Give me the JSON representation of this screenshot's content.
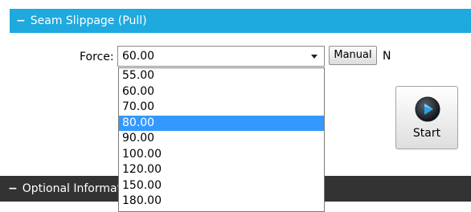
{
  "seam_section": {
    "toggle_symbol": "−",
    "title": "Seam Slippage (Pull)",
    "color": "#1ea9df"
  },
  "force": {
    "label": "Force:",
    "selected_value": "60.00",
    "highlighted_option": "80.00",
    "options": [
      "55.00",
      "60.00",
      "70.00",
      "80.00",
      "90.00",
      "100.00",
      "120.00",
      "150.00",
      "180.00"
    ],
    "manual_button_label": "Manual",
    "unit": "N"
  },
  "start_button": {
    "label": "Start",
    "icon": "play-icon"
  },
  "optional_section": {
    "toggle_symbol": "−",
    "title": "Optional Informati",
    "color": "#333333"
  },
  "colors": {
    "selection_highlight": "#3399ff"
  }
}
